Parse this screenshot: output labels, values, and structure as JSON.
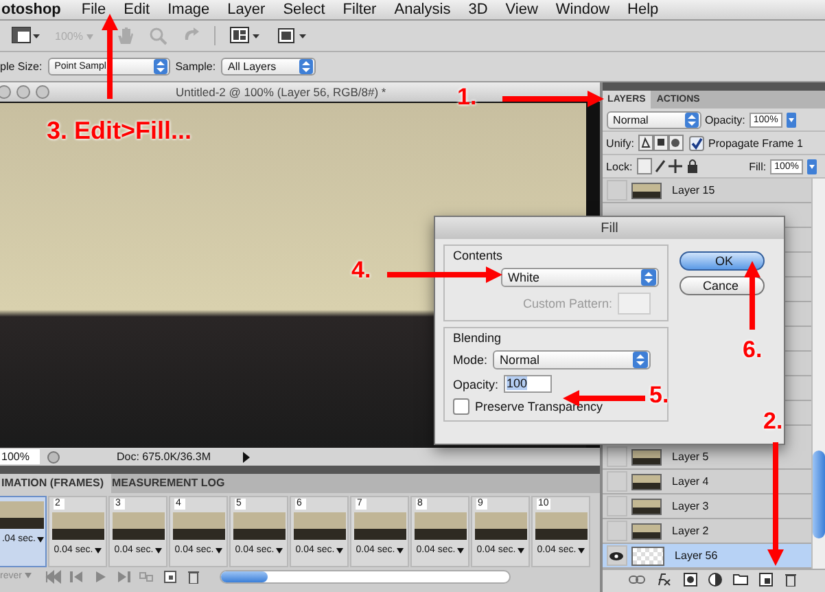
{
  "menu_bar": {
    "app_name": "otoshop",
    "items": [
      "File",
      "Edit",
      "Image",
      "Layer",
      "Select",
      "Filter",
      "Analysis",
      "3D",
      "View",
      "Window",
      "Help"
    ]
  },
  "toolbar": {
    "zoom": "100%"
  },
  "options_bar": {
    "sample_size_label": "ple Size:",
    "sample_size": "Point Sampl",
    "sample_label": "Sample:",
    "sample": "All Layers"
  },
  "document": {
    "title": "Untitled-2 @ 100% (Layer 56, RGB/8#) *",
    "zoom": "100%",
    "doc_info": "Doc: 675.0K/36.3M"
  },
  "animation_panel": {
    "tabs": [
      {
        "label": "IMATION (FRAMES)",
        "selected": true
      },
      {
        "label": "MEASUREMENT LOG",
        "selected": false
      }
    ],
    "frames": [
      {
        "delay": ".04 sec.",
        "selected": true
      },
      {
        "number": "2",
        "delay": "0.04 sec.",
        "selected": false
      },
      {
        "number": "3",
        "delay": "0.04 sec.",
        "selected": false
      },
      {
        "number": "4",
        "delay": "0.04 sec.",
        "selected": false
      },
      {
        "number": "5",
        "delay": "0.04 sec.",
        "selected": false
      },
      {
        "number": "6",
        "delay": "0.04 sec.",
        "selected": false
      },
      {
        "number": "7",
        "delay": "0.04 sec.",
        "selected": false
      },
      {
        "number": "8",
        "delay": "0.04 sec.",
        "selected": false
      },
      {
        "number": "9",
        "delay": "0.04 sec.",
        "selected": false
      },
      {
        "number": "10",
        "delay": "0.04 sec.",
        "selected": false
      }
    ],
    "loop": "rever"
  },
  "layers_panel": {
    "tabs": [
      {
        "label": "LAYERS",
        "selected": true
      },
      {
        "label": "ACTIONS",
        "selected": false
      }
    ],
    "blend_mode": "Normal",
    "opacity_label": "Opacity:",
    "opacity": "100%",
    "unify_label": "Unify:",
    "propagate": {
      "label": "Propagate Frame 1",
      "checked": true
    },
    "lock_label": "Lock:",
    "fill_label": "Fill:",
    "fill": "100%",
    "top_layers": [
      {
        "name": "Layer 15",
        "visible": false,
        "selected": false,
        "kind": "frame"
      }
    ],
    "bottom_layers": [
      {
        "name": "Layer 5",
        "visible": false,
        "selected": false,
        "kind": "frame"
      },
      {
        "name": "Layer 4",
        "visible": false,
        "selected": false,
        "kind": "frame"
      },
      {
        "name": "Layer 3",
        "visible": false,
        "selected": false,
        "kind": "frame"
      },
      {
        "name": "Layer 2",
        "visible": false,
        "selected": false,
        "kind": "frame"
      },
      {
        "name": "Layer 56",
        "visible": true,
        "selected": true,
        "kind": "transparent"
      }
    ]
  },
  "fill_dialog": {
    "title": "Fill",
    "contents_label": "Contents",
    "use": "White",
    "custom_pattern_label": "Custom Pattern:",
    "blending_label": "Blending",
    "mode_label": "Mode:",
    "mode": "Normal",
    "opacity_label": "Opacity:",
    "opacity": "100",
    "preserve": {
      "label": "Preserve Transparency",
      "checked": false
    },
    "buttons": [
      {
        "label": "OK",
        "kind": "default"
      },
      {
        "label": "Cance",
        "kind": "normal"
      }
    ]
  },
  "annotations": [
    {
      "label": "1."
    },
    {
      "label": "2."
    },
    {
      "label": "3. Edit>Fill..."
    },
    {
      "label": "4."
    },
    {
      "label": "5."
    },
    {
      "label": "6."
    }
  ]
}
